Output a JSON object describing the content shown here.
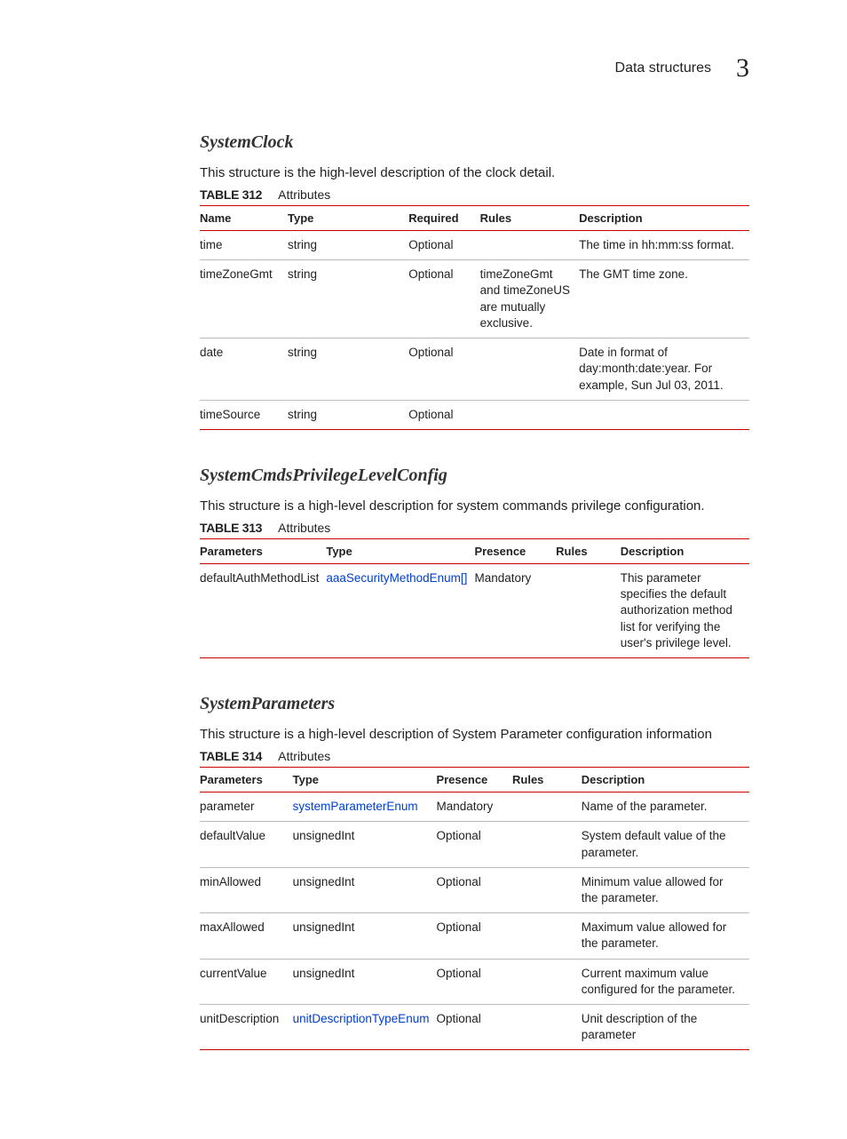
{
  "header": {
    "breadcrumb": "Data structures",
    "chapter": "3"
  },
  "sections": [
    {
      "title": "SystemClock",
      "desc": "This structure is the high-level description of the clock detail.",
      "table_number": "TABLE 312",
      "table_title": "Attributes",
      "columns": [
        "Name",
        "Type",
        "Required",
        "Rules",
        "Description"
      ],
      "rows": [
        {
          "c0": "time",
          "c1": "string",
          "c1_link": false,
          "c2": "Optional",
          "c3": "",
          "c4": "The time in hh:mm:ss format."
        },
        {
          "c0": "timeZoneGmt",
          "c1": "string",
          "c1_link": false,
          "c2": "Optional",
          "c3": "timeZoneGmt and timeZoneUS are mutually exclusive.",
          "c4": "The GMT time zone."
        },
        {
          "c0": "date",
          "c1": "string",
          "c1_link": false,
          "c2": "Optional",
          "c3": "",
          "c4": "Date in format of day:month:date:year. For example, Sun Jul 03, 2011."
        },
        {
          "c0": "timeSource",
          "c1": "string",
          "c1_link": false,
          "c2": "Optional",
          "c3": "",
          "c4": ""
        }
      ],
      "widths": [
        "16%",
        "22%",
        "13%",
        "18%",
        "31%"
      ]
    },
    {
      "title": "SystemCmdsPrivilegeLevelConfig",
      "desc": "This structure is a high-level description for system commands privilege configuration.",
      "table_number": "TABLE 313",
      "table_title": "Attributes",
      "columns": [
        "Parameters",
        "Type",
        "Presence",
        "Rules",
        "Description"
      ],
      "rows": [
        {
          "c0": "defaultAuthMethodList",
          "c1": "aaaSecurityMethodEnum[]",
          "c1_link": true,
          "c2": "Mandatory",
          "c3": "",
          "c4": "This parameter specifies the default authorization method list for verifying the user's privilege level."
        }
      ],
      "widths": [
        "22%",
        "27%",
        "15%",
        "12%",
        "24%"
      ]
    },
    {
      "title": "SystemParameters",
      "desc": "This structure is a high-level description of System Parameter configuration information",
      "table_number": "TABLE 314",
      "table_title": "Attributes",
      "columns": [
        "Parameters",
        "Type",
        "Presence",
        "Rules",
        "Description"
      ],
      "rows": [
        {
          "c0": "parameter",
          "c1": "systemParameterEnum",
          "c1_link": true,
          "c2": "Mandatory",
          "c3": "",
          "c4": "Name of the parameter."
        },
        {
          "c0": "defaultValue",
          "c1": "unsignedInt",
          "c1_link": false,
          "c2": "Optional",
          "c3": "",
          "c4": "System default value of the parameter."
        },
        {
          "c0": "minAllowed",
          "c1": "unsignedInt",
          "c1_link": false,
          "c2": "Optional",
          "c3": "",
          "c4": "Minimum value allowed for the parameter."
        },
        {
          "c0": "maxAllowed",
          "c1": "unsignedInt",
          "c1_link": false,
          "c2": "Optional",
          "c3": "",
          "c4": "Maximum value allowed for the parameter."
        },
        {
          "c0": "currentValue",
          "c1": "unsignedInt",
          "c1_link": false,
          "c2": "Optional",
          "c3": "",
          "c4": "Current maximum value configured for the parameter."
        },
        {
          "c0": "unitDescription",
          "c1": "unitDescriptionTypeEnum",
          "c1_link": true,
          "c2": "Optional",
          "c3": "",
          "c4": "Unit description of the parameter"
        }
      ],
      "widths": [
        "17%",
        "24%",
        "14%",
        "13%",
        "32%"
      ]
    }
  ]
}
